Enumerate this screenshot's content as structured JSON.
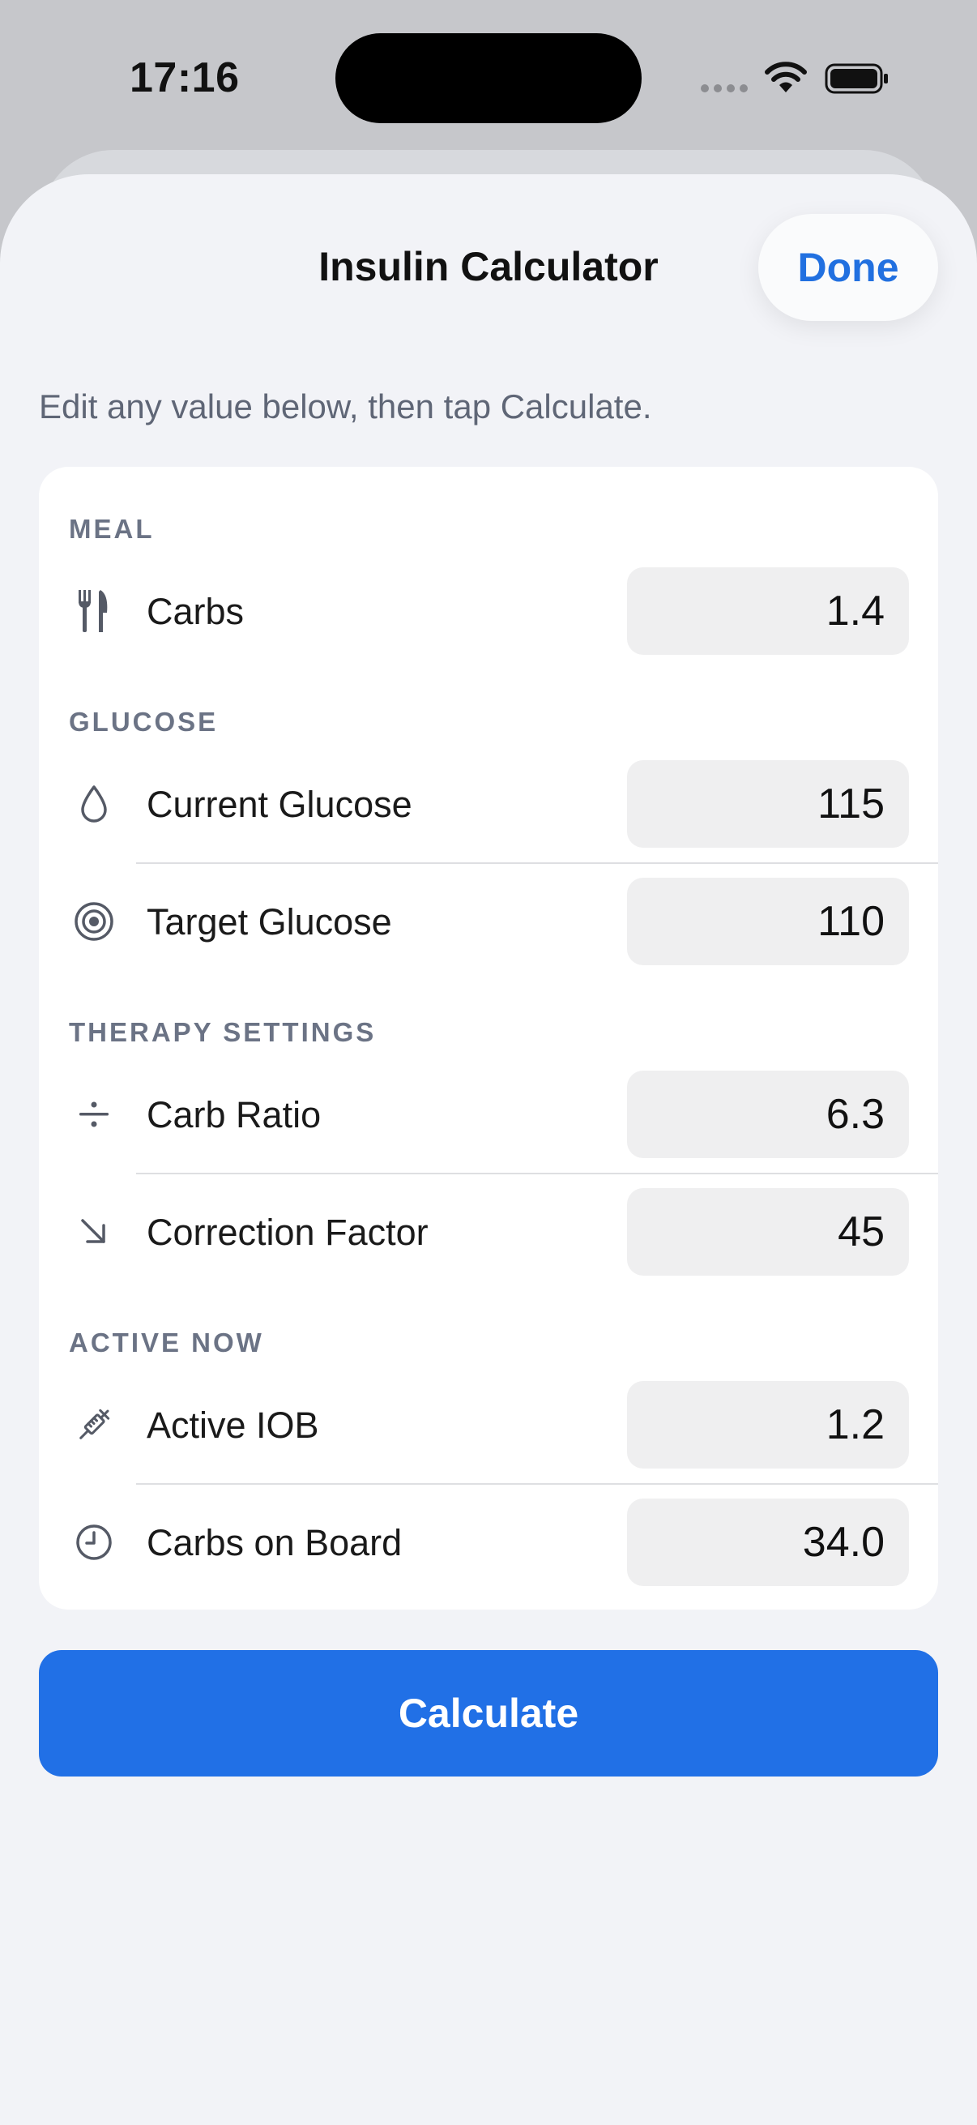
{
  "status_bar": {
    "time": "17:16"
  },
  "header": {
    "title": "Insulin Calculator",
    "done_label": "Done"
  },
  "subtitle": "Edit any value below, then tap Calculate.",
  "sections": {
    "meal": "MEAL",
    "glucose": "GLUCOSE",
    "therapy": "THERAPY SETTINGS",
    "active": "ACTIVE NOW"
  },
  "fields": {
    "carbs": {
      "label": "Carbs",
      "value": "1.4",
      "icon": "fork-knife-icon"
    },
    "current_glucose": {
      "label": "Current Glucose",
      "value": "115",
      "icon": "drop-icon"
    },
    "target_glucose": {
      "label": "Target Glucose",
      "value": "110",
      "icon": "target-icon"
    },
    "carb_ratio": {
      "label": "Carb Ratio",
      "value": "6.3",
      "icon": "divide-icon"
    },
    "correction_factor": {
      "label": "Correction Factor",
      "value": "45",
      "icon": "arrow-down-right-icon"
    },
    "active_iob": {
      "label": "Active IOB",
      "value": "1.2",
      "icon": "syringe-icon"
    },
    "carbs_on_board": {
      "label": "Carbs on Board",
      "value": "34.0",
      "icon": "clock-icon"
    }
  },
  "calculate_label": "Calculate",
  "colors": {
    "accent": "#2170e6",
    "background": "#f2f3f7",
    "card": "#ffffff",
    "field": "#efeff0"
  }
}
